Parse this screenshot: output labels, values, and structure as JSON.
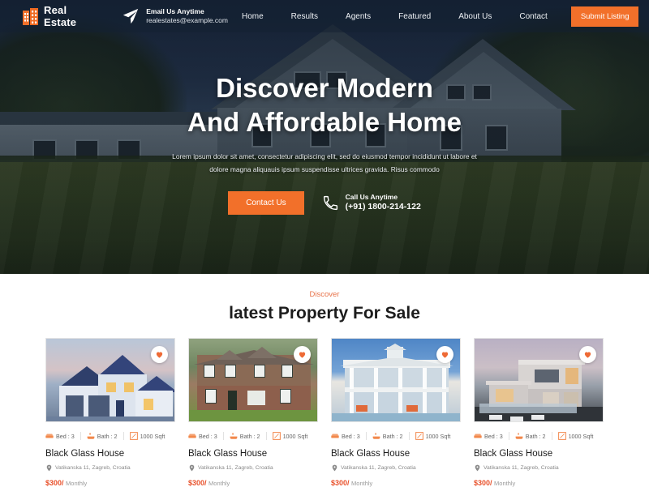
{
  "header": {
    "logo": {
      "text": "Real Estate",
      "icon": "building-icon"
    },
    "email": {
      "icon": "paper-plane-icon",
      "title": "Email Us Anytime",
      "address": "realestates@example.com"
    },
    "nav": [
      {
        "label": "Home"
      },
      {
        "label": "Results"
      },
      {
        "label": "Agents"
      },
      {
        "label": "Featured"
      },
      {
        "label": "About Us"
      },
      {
        "label": "Contact"
      }
    ],
    "submit_label": "Submit Listing"
  },
  "hero": {
    "title_line1": "Discover Modern",
    "title_line2": "And Affordable Home",
    "subtitle": "Lorem ipsum dolor sit amet, consectetur adipiscing elit, sed do eiusmod tempor incididunt ut labore et dolore magna aliquauis ipsum suspendisse ultrices gravida. Risus commodo",
    "cta_label": "Contact Us",
    "call": {
      "icon": "phone-icon",
      "title": "Call Us Anytime",
      "number": "(+91) 1800-214-122"
    }
  },
  "properties": {
    "eyebrow": "Discover",
    "title": "latest Property For Sale",
    "favorite_icon": "heart-icon",
    "cards": [
      {
        "image": "blue-suburban-house",
        "bed": "Bed : 3",
        "bath": "Bath : 2",
        "area": "1000 Sqft",
        "title": "Black Glass House",
        "address": "Vatikanska 11, Zagreb, Croatia",
        "price_amount": "$300/",
        "price_period": "Monthly"
      },
      {
        "image": "brick-colonial-house",
        "bed": "Bed : 3",
        "bath": "Bath : 2",
        "area": "1000 Sqft",
        "title": "Black Glass House",
        "address": "Vatikanska 11, Zagreb, Croatia",
        "price_amount": "$300/",
        "price_period": "Monthly"
      },
      {
        "image": "white-coastal-house",
        "bed": "Bed : 3",
        "bath": "Bath : 2",
        "area": "1000 Sqft",
        "title": "Black Glass House",
        "address": "Vatikanska 11, Zagreb, Croatia",
        "price_amount": "$300/",
        "price_period": "Monthly"
      },
      {
        "image": "modern-villa-pool",
        "bed": "Bed : 3",
        "bath": "Bath : 2",
        "area": "1000 Sqft",
        "title": "Black Glass House",
        "address": "Vatikanska 11, Zagreb, Croatia",
        "price_amount": "$300/",
        "price_period": "Monthly"
      }
    ]
  },
  "colors": {
    "accent_orange": "#f2702a",
    "price_red": "#e8502a",
    "eyebrow": "#e8734a",
    "hero_dark": "#1b2a42"
  }
}
